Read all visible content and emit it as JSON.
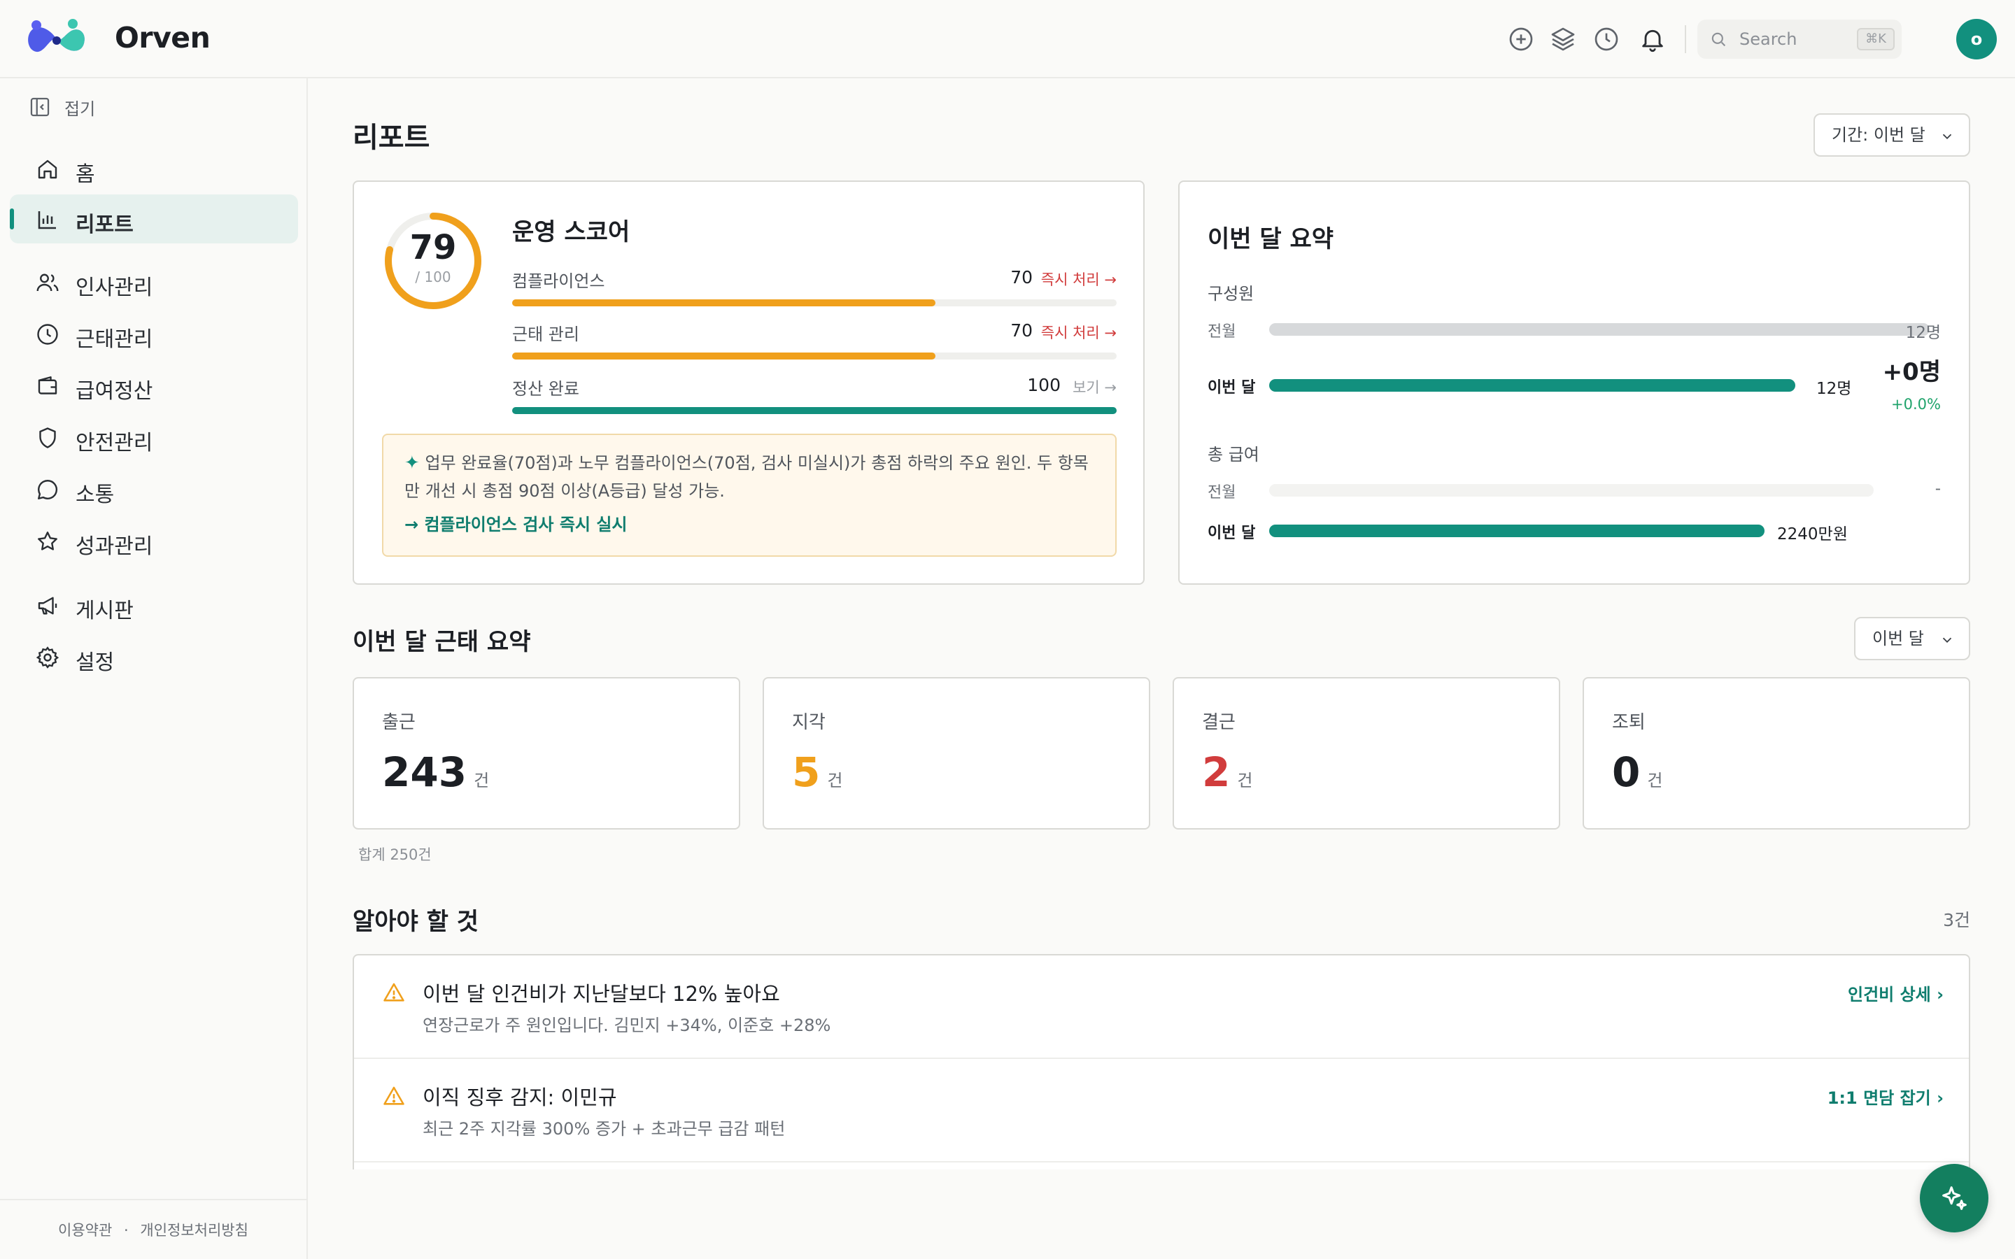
{
  "app": {
    "name": "Orven"
  },
  "topbar": {
    "icons": [
      "plus-circle-icon",
      "layers-icon",
      "clock-icon",
      "bell-icon"
    ],
    "search": {
      "placeholder": "Search",
      "shortcut": "⌘K"
    },
    "avatar_initial": "o"
  },
  "sidebar": {
    "collapse_label": "접기",
    "items": [
      {
        "label": "홈",
        "icon": "home-icon",
        "active": false
      },
      {
        "label": "리포트",
        "icon": "bar-chart-icon",
        "active": true
      },
      {
        "label": "인사관리",
        "icon": "users-icon",
        "active": false
      },
      {
        "label": "근태관리",
        "icon": "clock-icon",
        "active": false
      },
      {
        "label": "급여정산",
        "icon": "wallet-icon",
        "active": false
      },
      {
        "label": "안전관리",
        "icon": "shield-icon",
        "active": false
      },
      {
        "label": "소통",
        "icon": "chat-icon",
        "active": false
      },
      {
        "label": "성과관리",
        "icon": "star-icon",
        "active": false
      },
      {
        "label": "게시판",
        "icon": "megaphone-icon",
        "active": false
      },
      {
        "label": "설정",
        "icon": "gear-icon",
        "active": false
      }
    ],
    "footer": {
      "terms": "이용약관",
      "separator": "·",
      "privacy": "개인정보처리방침"
    }
  },
  "main": {
    "title": "리포트",
    "period_filter": "기간: 이번 달",
    "score_card": {
      "score": "79",
      "max": "/ 100",
      "score_fraction": 0.79,
      "title": "운영 스코어",
      "metrics": [
        {
          "label": "컴플라이언스",
          "value": "70",
          "action": "즉시 처리 →",
          "action_color": "#d13c3c",
          "fill_percent": 70,
          "bar_color": "#f0a01c"
        },
        {
          "label": "근태 관리",
          "value": "70",
          "action": "즉시 처리 →",
          "action_color": "#d13c3c",
          "fill_percent": 70,
          "bar_color": "#f0a01c"
        },
        {
          "label": "정산 완료",
          "value": "100",
          "action": "보기 →",
          "action_color": "#9a9ea3",
          "fill_percent": 100,
          "bar_color": "#12907e"
        }
      ],
      "insight": {
        "star": "✦",
        "text": "업무 완료율(70점)과 노무 컴플라이언스(70점, 검사 미실시)가 총점 하락의 주요 원인. 두 항목만 개선 시 총점 90점 이상(A등급) 달성 가능.",
        "link": "→ 컴플라이언스 검사 즉시 실시"
      }
    },
    "summary_card": {
      "title": "이번 달 요약",
      "members": {
        "label": "구성원",
        "prev_label": "전월",
        "prev_value": "12명",
        "prev_fill_percent": 100,
        "curr_label": "이번 달",
        "curr_value": "12명",
        "curr_fill_percent": 100,
        "delta": "+0명",
        "delta_pct": "+0.0%"
      },
      "payroll": {
        "label": "총 급여",
        "prev_label": "전월",
        "prev_value": "-",
        "prev_fill_percent": 0,
        "curr_label": "이번 달",
        "curr_value": "2240만원",
        "curr_fill_percent": 100
      }
    },
    "attendance": {
      "title": "이번 달 근태 요약",
      "filter": "이번 달",
      "cards": [
        {
          "label": "출근",
          "value": "243",
          "unit": "건",
          "color": "#1c1f24"
        },
        {
          "label": "지각",
          "value": "5",
          "unit": "건",
          "color": "#f0a01c"
        },
        {
          "label": "결근",
          "value": "2",
          "unit": "건",
          "color": "#d13c3c"
        },
        {
          "label": "조퇴",
          "value": "0",
          "unit": "건",
          "color": "#1c1f24"
        }
      ],
      "total": "합계 250건"
    },
    "alerts": {
      "title": "알아야 할 것",
      "count": "3건",
      "items": [
        {
          "title": "이번 달 인건비가 지난달보다 12% 높아요",
          "desc": "연장근로가 주 원인입니다. 김민지 +34%, 이준호 +28%",
          "link": "인건비 상세 ›"
        },
        {
          "title": "이직 징후 감지: 이민규",
          "desc": "최근 2주 지각률 300% 증가 + 초과근무 급감 패턴",
          "link": "1:1 면담 잡기 ›"
        }
      ]
    }
  },
  "colors": {
    "accent": "#12907e",
    "warning": "#f0a01c",
    "danger": "#d13c3c",
    "success": "#1fa36b"
  }
}
